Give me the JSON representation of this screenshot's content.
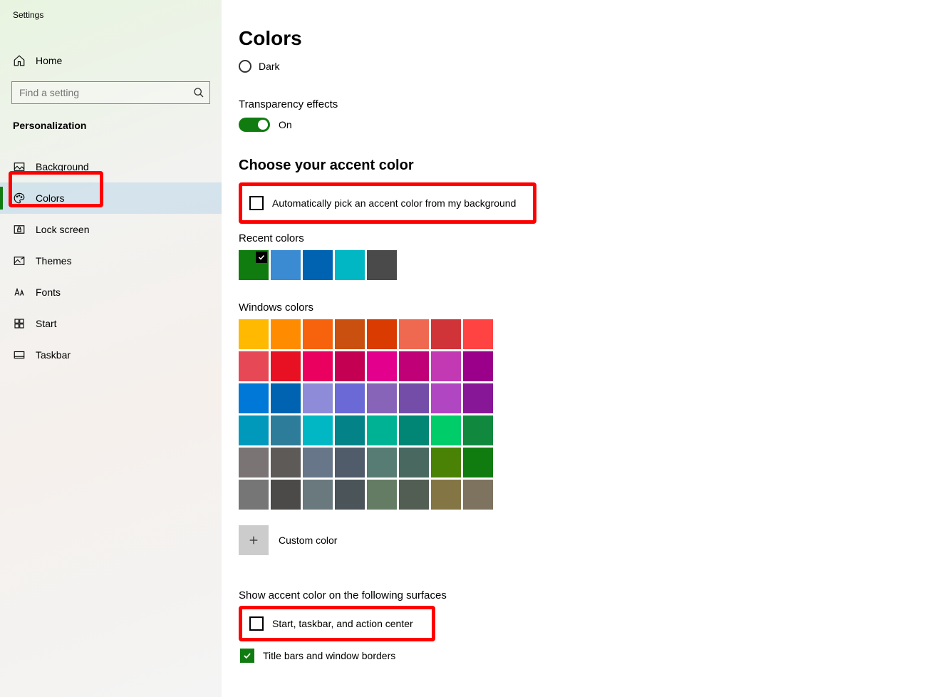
{
  "app_title": "Settings",
  "nav_home": "Home",
  "search_placeholder": "Find a setting",
  "section_name": "Personalization",
  "nav_items": [
    {
      "label": "Background"
    },
    {
      "label": "Colors"
    },
    {
      "label": "Lock screen"
    },
    {
      "label": "Themes"
    },
    {
      "label": "Fonts"
    },
    {
      "label": "Start"
    },
    {
      "label": "Taskbar"
    }
  ],
  "page": {
    "title": "Colors",
    "mode_option": "Dark",
    "transparency_label": "Transparency effects",
    "transparency_state": "On",
    "accent_heading": "Choose your accent color",
    "auto_pick_label": "Automatically pick an accent color from my background",
    "recent_label": "Recent colors",
    "recent_colors": [
      "#107c10",
      "#3a8bd1",
      "#0063b1",
      "#00b7c3",
      "#4a4a4a"
    ],
    "windows_colors_label": "Windows colors",
    "windows_colors": [
      "#ffb900",
      "#ff8c00",
      "#f7630c",
      "#ca5010",
      "#da3b01",
      "#ef6950",
      "#d13438",
      "#ff4343",
      "#e74856",
      "#e81123",
      "#ea005e",
      "#c30052",
      "#e3008c",
      "#bf0077",
      "#c239b3",
      "#9a0089",
      "#0078d7",
      "#0063b1",
      "#8e8cd8",
      "#6b69d6",
      "#8764b8",
      "#744da9",
      "#b146c2",
      "#881798",
      "#0099bc",
      "#2d7d9a",
      "#00b7c3",
      "#038387",
      "#00b294",
      "#018574",
      "#00cc6a",
      "#10893e",
      "#7a7574",
      "#5d5a58",
      "#68768a",
      "#515c6b",
      "#567c73",
      "#486860",
      "#498205",
      "#107c10",
      "#767676",
      "#4c4a48",
      "#69797e",
      "#4a5459",
      "#647c64",
      "#525e54",
      "#847545",
      "#7e735f"
    ],
    "custom_label": "Custom color",
    "surfaces_heading": "Show accent color on the following surfaces",
    "surface_start": "Start, taskbar, and action center",
    "surface_title": "Title bars and window borders"
  }
}
